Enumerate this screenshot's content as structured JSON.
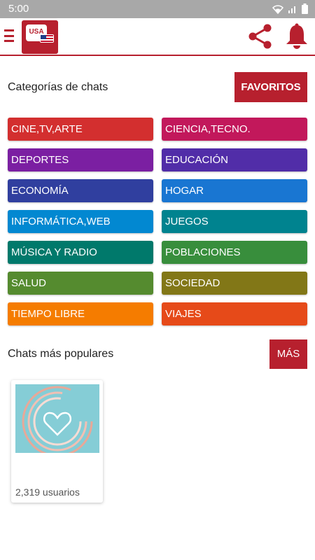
{
  "status_bar": {
    "time": "5:00"
  },
  "header": {
    "logo_text": "USA",
    "icons": [
      "menu-icon",
      "share-icon",
      "bell-icon"
    ],
    "accent_color": "#b7202e"
  },
  "categories_section": {
    "title": "Categorías de chats",
    "favorites_label": "FAVORITOS",
    "items": [
      {
        "label": "CINE,TV,ARTE",
        "color": "#d32f2f"
      },
      {
        "label": "CIENCIA,TECNO.",
        "color": "#c2185b"
      },
      {
        "label": "DEPORTES",
        "color": "#7b1fa2"
      },
      {
        "label": "EDUCACIÓN",
        "color": "#512da8"
      },
      {
        "label": "ECONOMÍA",
        "color": "#303f9f"
      },
      {
        "label": "HOGAR",
        "color": "#1976d2"
      },
      {
        "label": "INFORMÁTICA,WEB",
        "color": "#0288d1"
      },
      {
        "label": "JUEGOS",
        "color": "#00838f"
      },
      {
        "label": "MÚSICA Y RADIO",
        "color": "#00796b"
      },
      {
        "label": "POBLACIONES",
        "color": "#388e3c"
      },
      {
        "label": "SALUD",
        "color": "#558b2f"
      },
      {
        "label": "SOCIEDAD",
        "color": "#827717"
      },
      {
        "label": "TIEMPO LIBRE",
        "color": "#f57c00"
      },
      {
        "label": "VIAJES",
        "color": "#e64a19"
      }
    ]
  },
  "popular_section": {
    "title": "Chats más populares",
    "more_label": "MÁS",
    "chats": [
      {
        "users": "2,319 usuarios"
      }
    ]
  }
}
